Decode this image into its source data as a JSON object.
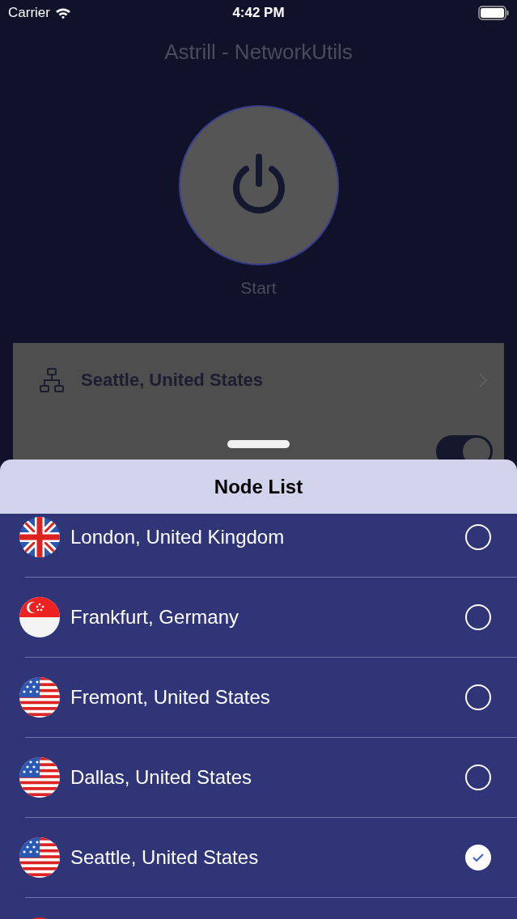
{
  "status_bar": {
    "carrier": "Carrier",
    "time": "4:42 PM"
  },
  "title": "Astrill - NetworkUtils",
  "power": {
    "label": "Start"
  },
  "current_node": {
    "name": "Seattle, United States"
  },
  "toggle": {
    "on": true
  },
  "sheet": {
    "title": "Node List",
    "nodes": [
      {
        "name": "London, United Kingdom",
        "kind": "uk",
        "selected": false
      },
      {
        "name": "Frankfurt, Germany",
        "kind": "sg",
        "selected": false
      },
      {
        "name": "Fremont, United States",
        "kind": "us",
        "selected": false
      },
      {
        "name": "Dallas, United States",
        "kind": "us",
        "selected": false
      },
      {
        "name": "Seattle, United States",
        "kind": "us",
        "selected": true
      }
    ]
  }
}
